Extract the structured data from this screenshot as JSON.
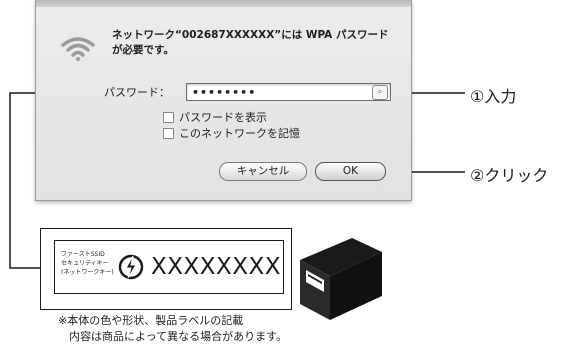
{
  "dialog": {
    "message_line1": "ネットワーク“002687XXXXXX”には WPA パスワード",
    "message_line2": "が必要です。",
    "password_label": "パスワード：",
    "password_value": "••••••••",
    "password_key_glyph": "⌕",
    "checkbox_show_password": "パスワードを表示",
    "checkbox_remember_network": "このネットワークを記憶",
    "cancel_button": "キャンセル",
    "ok_button": "OK"
  },
  "callouts": {
    "step1": "①入力",
    "step2": "②クリック"
  },
  "product_label": {
    "line1": "ファーストSSID",
    "line2": "セキュリティキー",
    "line3": "(ネットワークキー)",
    "code": "XXXXXXXX",
    "logo_icon": "wireless-brand-icon"
  },
  "note": {
    "line1": "※本体の色や形状、製品ラベルの記載",
    "line2": "内容は商品によって異なる場合があります。"
  },
  "colors": {
    "line": "#1a1a1a",
    "dialog_bg": "#e6e6e6",
    "router_body": "#1a1a1a"
  }
}
